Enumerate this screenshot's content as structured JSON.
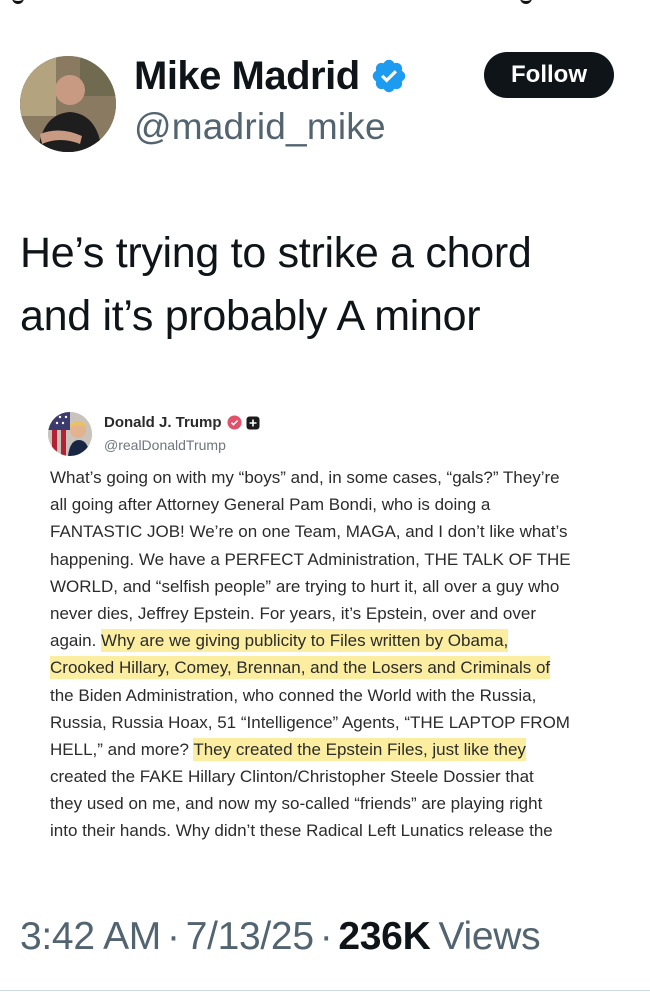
{
  "author": {
    "display_name": "Mike Madrid",
    "handle": "@madrid_mike",
    "follow_label": "Follow"
  },
  "tweet": {
    "text_lines": [
      "He’s trying to strike a chord",
      "and it’s probably A minor"
    ]
  },
  "embedded_post": {
    "display_name": "Donald J. Trump",
    "handle": "@realDonaldTrump",
    "lines": [
      {
        "parts": [
          {
            "text": "What’s going on with my “boys” and, in some cases, “gals?” They’re",
            "hl": false
          }
        ]
      },
      {
        "parts": [
          {
            "text": "all going after Attorney General Pam Bondi, who is doing a",
            "hl": false
          }
        ]
      },
      {
        "parts": [
          {
            "text": "FANTASTIC JOB! We’re on one Team, MAGA, and I don’t like what’s",
            "hl": false
          }
        ]
      },
      {
        "parts": [
          {
            "text": "happening. We have a PERFECT Administration, THE TALK OF THE",
            "hl": false
          }
        ]
      },
      {
        "parts": [
          {
            "text": "WORLD, and “selfish people” are trying to hurt it, all over a guy who",
            "hl": false
          }
        ]
      },
      {
        "parts": [
          {
            "text": "never dies, Jeffrey Epstein. For years, it’s Epstein, over and over",
            "hl": false
          }
        ]
      },
      {
        "parts": [
          {
            "text": "again. ",
            "hl": false
          },
          {
            "text": "Why are we giving publicity to Files written by Obama,",
            "hl": true
          }
        ]
      },
      {
        "parts": [
          {
            "text": "Crooked Hillary, Comey, Brennan, and the Losers and Criminals of",
            "hl": true
          }
        ]
      },
      {
        "parts": [
          {
            "text": "the Biden Administration, who conned the World with the Russia,",
            "hl": false
          }
        ]
      },
      {
        "parts": [
          {
            "text": "Russia, Russia Hoax, 51 “Intelligence” Agents, “THE LAPTOP FROM",
            "hl": false
          }
        ]
      },
      {
        "parts": [
          {
            "text": "HELL,” and more? ",
            "hl": false
          },
          {
            "text": "They created the Epstein Files, just like they",
            "hl": true
          }
        ]
      },
      {
        "parts": [
          {
            "text": "created the FAKE Hillary Clinton/Christopher Steele Dossier that",
            "hl": false
          }
        ]
      },
      {
        "parts": [
          {
            "text": "they used on me, and now my so-called “friends” are playing right",
            "hl": false
          }
        ]
      },
      {
        "parts": [
          {
            "text": "into their hands. Why didn’t these Radical Left Lunatics release the",
            "hl": false
          }
        ]
      }
    ]
  },
  "meta": {
    "time": "3:42 AM",
    "separator": "·",
    "date": "7/13/25",
    "views_count": "236K",
    "views_label": "Views"
  },
  "colors": {
    "text": "#0f1419",
    "secondary": "#536471",
    "verified_blue": "#1d9bf0",
    "highlight": "#fbeea0",
    "button_bg": "#0f1419"
  },
  "icons": {
    "verified": "verified-badge-icon",
    "embedded_badge": "verified-badge-icon",
    "embedded_square": "square-badge-icon"
  }
}
